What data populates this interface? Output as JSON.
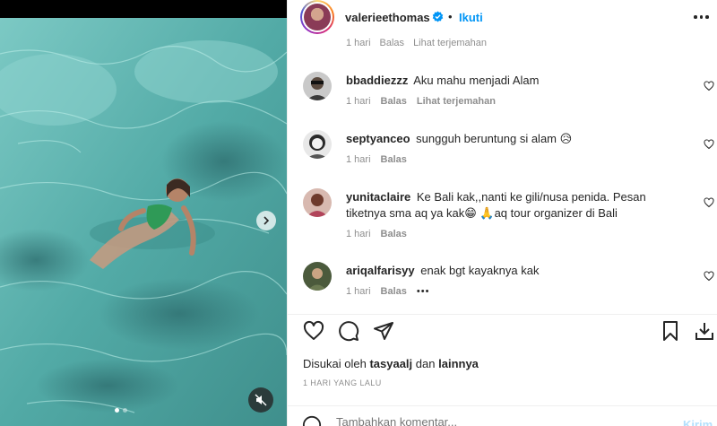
{
  "post": {
    "media": {
      "carousel_dots": 2,
      "active_dot": 0
    },
    "author": {
      "username": "valerieethomas",
      "separator": "•",
      "follow_label": "Ikuti"
    },
    "partial_comment_meta": {
      "time": "1 hari",
      "reply": "Balas",
      "translate": "Lihat terjemahan"
    },
    "comments": [
      {
        "username": "bbaddiezzz",
        "text": "Aku mahu menjadi Alam",
        "time": "1 hari",
        "reply": "Balas",
        "translate": "Lihat terjemahan"
      },
      {
        "username": "septyanceo",
        "text": "sungguh beruntung si alam 😥",
        "time": "1 hari",
        "reply": "Balas"
      },
      {
        "username": "yunitaclaire",
        "text": "Ke Bali kak,,nanti ke gili/nusa penida. Pesan tiketnya sma aq ya kak😁 🙏aq tour organizer di Bali",
        "time": "1 hari",
        "reply": "Balas"
      },
      {
        "username": "ariqalfarisyy",
        "text": "enak bgt kayaknya kak",
        "time": "1 hari",
        "reply": "Balas",
        "more": "•••"
      }
    ],
    "likes": {
      "prefix": "Disukai oleh",
      "user": "tasyaalj",
      "joiner": "dan",
      "others": "lainnya"
    },
    "date": "1 HARI YANG LALU",
    "add_comment": {
      "placeholder": "Tambahkan komentar...",
      "post_label": "Kirim"
    },
    "colors": {
      "accent": "#0095f6",
      "muted": "#8e8e8e",
      "text": "#262626",
      "water": "#4fa9a4"
    },
    "icons": [
      "verified-icon",
      "more-icon",
      "heart-icon",
      "comment-icon",
      "share-icon",
      "bookmark-icon",
      "download-icon",
      "mute-icon",
      "chevron-right-icon",
      "emoji-icon"
    ]
  }
}
